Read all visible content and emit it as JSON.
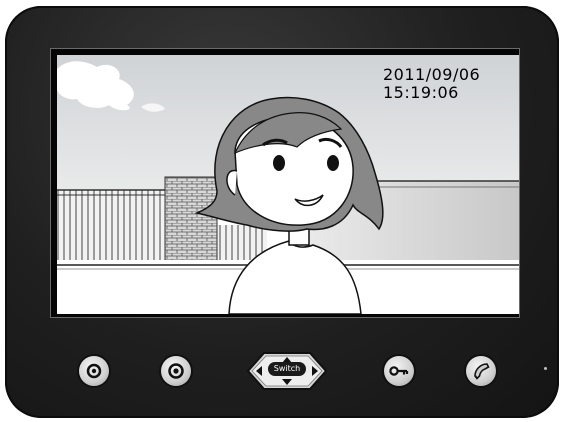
{
  "device": {
    "name": "video door phone monitor",
    "body_color": "#1f1f1f"
  },
  "screen": {
    "osd": {
      "date": "2011/09/06",
      "time": "15:19:06"
    }
  },
  "controls": {
    "buttons": [
      {
        "id": "monitor",
        "icon": "monitor-icon"
      },
      {
        "id": "record",
        "icon": "record-icon"
      },
      {
        "id": "unlock",
        "icon": "key-icon"
      },
      {
        "id": "talk",
        "icon": "handset-icon"
      }
    ],
    "nav": {
      "switch_label": "Switch",
      "arrows": [
        "up",
        "down",
        "left",
        "right"
      ]
    }
  }
}
